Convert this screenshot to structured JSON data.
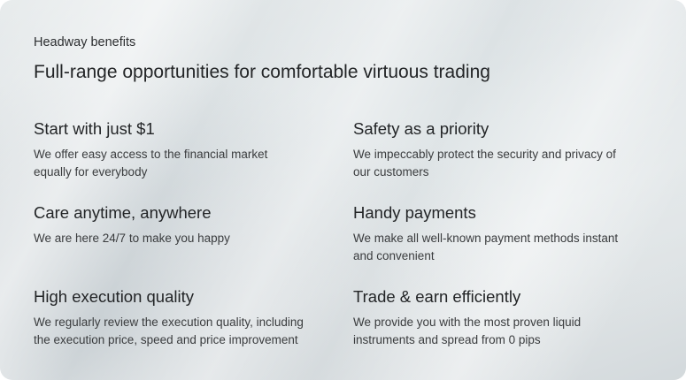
{
  "header": {
    "eyebrow": "Headway benefits",
    "headline": "Full-range opportunities for comfortable virtuous trading"
  },
  "features": [
    {
      "title": "Start with just $1",
      "description": "We offer easy access to the financial market equally for everybody"
    },
    {
      "title": "Safety as a priority",
      "description": "We impeccably protect the security and privacy of our customers"
    },
    {
      "title": "Care anytime, anywhere",
      "description": "We are here 24/7 to make you happy"
    },
    {
      "title": "Handy payments",
      "description": "We make all well-known payment methods instant and convenient"
    },
    {
      "title": "High execution quality",
      "description": "We regularly review the execution quality, including the execution price, speed and price improvement"
    },
    {
      "title": "Trade & earn efficiently",
      "description": "We provide you with the most proven liquid instruments and spread from 0 pips"
    }
  ]
}
